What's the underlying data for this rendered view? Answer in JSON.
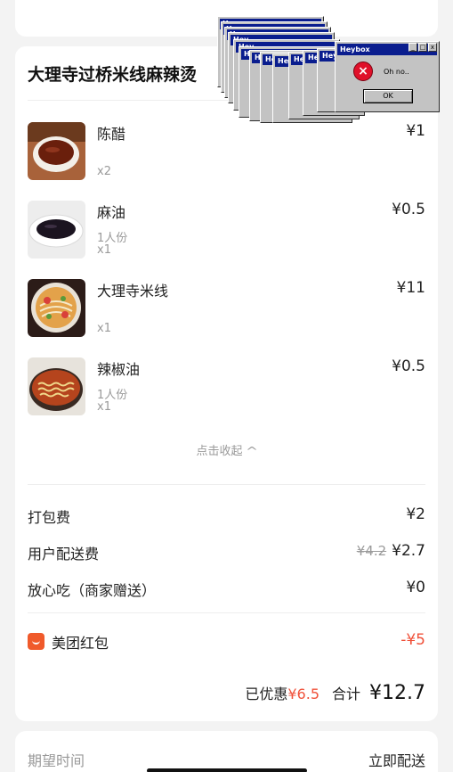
{
  "store": {
    "title": "大理寺过桥米线麻辣烫"
  },
  "items": [
    {
      "name": "陈醋",
      "portion": "",
      "qty": "x2",
      "price": "¥1",
      "image": "vinegar-bowl"
    },
    {
      "name": "麻油",
      "portion": "1人份",
      "qty": "x1",
      "price": "¥0.5",
      "image": "sesame-oil-dish"
    },
    {
      "name": "大理寺米线",
      "portion": "",
      "qty": "x1",
      "price": "¥11",
      "image": "rice-noodle-bowl"
    },
    {
      "name": "辣椒油",
      "portion": "1人份",
      "qty": "x1",
      "price": "¥0.5",
      "image": "chili-oil-bowl"
    }
  ],
  "collapse": {
    "label": "点击收起",
    "icon": "chevron-up-icon"
  },
  "fees": {
    "packing": {
      "label": "打包费",
      "value": "¥2"
    },
    "delivery": {
      "label": "用户配送费",
      "original": "¥4.2",
      "value": "¥2.7"
    },
    "insurance": {
      "label": "放心吃（商家赠送）",
      "value": "¥0"
    }
  },
  "coupon": {
    "label": "美团红包",
    "value": "-¥5",
    "icon": "red-packet-icon"
  },
  "summary": {
    "discount_label": "已优惠",
    "discount_value": "¥6.5",
    "total_label": "合计",
    "total_value": "¥12.7"
  },
  "expect": {
    "label": "期望时间",
    "value": "立即配送"
  },
  "dialogs": {
    "title": "Heybox",
    "short_title": "Hey",
    "message": "Oh no..",
    "ok_label": "OK",
    "icon": "error-x-icon"
  },
  "colors": {
    "accent_red": "#f0513a",
    "dialog_title_blue": "#0a1d8e"
  }
}
